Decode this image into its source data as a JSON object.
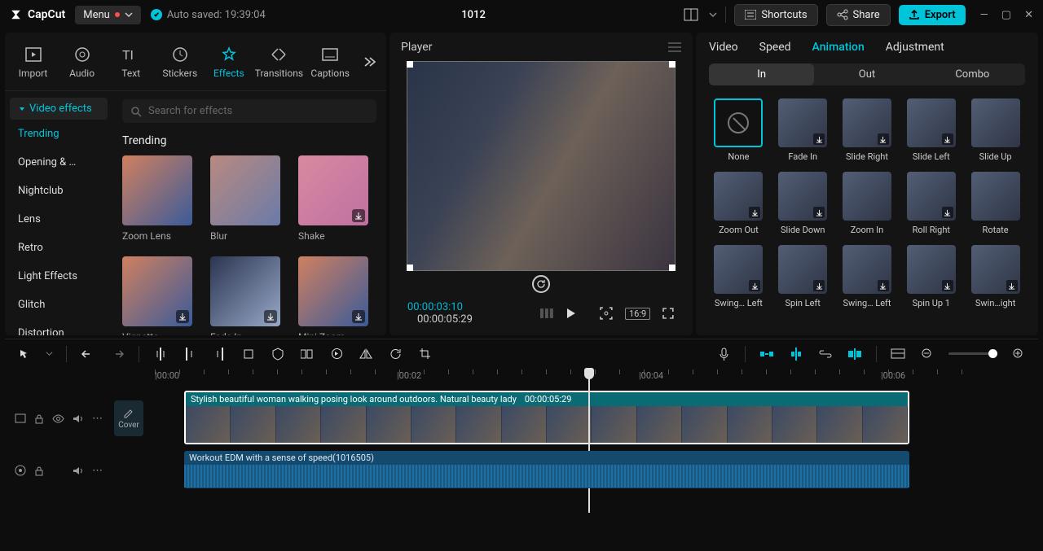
{
  "titlebar": {
    "logo": "CapCut",
    "menu": "Menu",
    "autosave": "Auto saved: 19:39:04",
    "project": "1012",
    "shortcuts": "Shortcuts",
    "share": "Share",
    "export": "Export"
  },
  "left_tabs": [
    "Import",
    "Audio",
    "Text",
    "Stickers",
    "Effects",
    "Transitions",
    "Captions"
  ],
  "left_active_tab": 4,
  "left_side": {
    "header": "Video effects",
    "items": [
      "Trending",
      "Opening & …",
      "Nightclub",
      "Lens",
      "Retro",
      "Light Effects",
      "Glitch",
      "Distortion"
    ],
    "active": 0
  },
  "search_placeholder": "Search for effects",
  "section_title": "Trending",
  "effects": [
    {
      "name": "Zoom Lens",
      "dl": false
    },
    {
      "name": "Blur",
      "dl": false
    },
    {
      "name": "Shake",
      "dl": true
    },
    {
      "name": "Vignette",
      "dl": true
    },
    {
      "name": "Fade In",
      "dl": true
    },
    {
      "name": "Mini Zoom",
      "dl": true
    }
  ],
  "player": {
    "title": "Player",
    "current_time": "00:00:03:10",
    "total_time": "00:00:05:29",
    "aspect": "16:9"
  },
  "right_tabs": [
    "Video",
    "Speed",
    "Animation",
    "Adjustment"
  ],
  "right_active_tab": 2,
  "sub_tabs": [
    "In",
    "Out",
    "Combo"
  ],
  "sub_active": 0,
  "animations": [
    {
      "name": "None",
      "none": true
    },
    {
      "name": "Fade In",
      "dl": true
    },
    {
      "name": "Slide Right",
      "dl": true
    },
    {
      "name": "Slide Left",
      "dl": true
    },
    {
      "name": "Slide Up",
      "dl": false
    },
    {
      "name": "Zoom Out",
      "dl": true
    },
    {
      "name": "Slide Down",
      "dl": true
    },
    {
      "name": "Zoom In",
      "dl": false
    },
    {
      "name": "Roll Right",
      "dl": true
    },
    {
      "name": "Rotate",
      "dl": false
    },
    {
      "name": "Swing… Left",
      "dl": true
    },
    {
      "name": "Spin Left",
      "dl": true
    },
    {
      "name": "Swing… Left",
      "dl": true
    },
    {
      "name": "Spin Up 1",
      "dl": true
    },
    {
      "name": "Swin…ight",
      "dl": true
    }
  ],
  "ruler": [
    "|00:00",
    "|00:02",
    "|00:04",
    "|00:06"
  ],
  "video_clip": {
    "title": "Stylish beautiful woman walking posing look around outdoors. Natural beauty lady",
    "duration": "00:00:05:29"
  },
  "audio_clip": {
    "title": "Workout EDM with a sense of speed(1016505)"
  },
  "cover_label": "Cover"
}
